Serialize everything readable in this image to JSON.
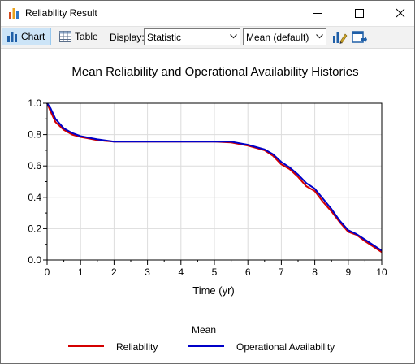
{
  "window": {
    "title": "Reliability Result",
    "controls": [
      "minimize",
      "maximize",
      "close"
    ]
  },
  "toolbar": {
    "chart_label": "Chart",
    "table_label": "Table",
    "display_label": "Display:",
    "display_select": "Statistic",
    "statistic_select": "Mean (default)",
    "icons": [
      "chart-properties-icon",
      "export-icon"
    ]
  },
  "colors": {
    "reliability": "#d40000",
    "availability": "#0000c8",
    "selected_tab": "#cce4f7"
  },
  "chart_data": {
    "type": "line",
    "title": "Mean Reliability and Operational Availability Histories",
    "xlabel": "Time (yr)",
    "ylabel": "",
    "xlim": [
      0,
      10
    ],
    "ylim": [
      0,
      1.0
    ],
    "x_ticks": [
      "0",
      "1",
      "2",
      "3",
      "4",
      "5",
      "6",
      "7",
      "8",
      "9",
      "10"
    ],
    "y_ticks": [
      "0.0",
      "0.2",
      "0.4",
      "0.6",
      "0.8",
      "1.0"
    ],
    "grid": true,
    "legend_title": "Mean",
    "legend_position": "bottom",
    "series": [
      {
        "name": "Reliability",
        "color": "#d40000",
        "x": [
          0,
          0.1,
          0.25,
          0.5,
          0.75,
          1.0,
          1.25,
          1.5,
          2.0,
          3.0,
          4.0,
          5.0,
          5.5,
          6.0,
          6.25,
          6.5,
          6.75,
          7.0,
          7.25,
          7.5,
          7.75,
          8.0,
          8.25,
          8.5,
          8.75,
          9.0,
          9.25,
          9.5,
          10.0
        ],
        "y": [
          1.0,
          0.95,
          0.88,
          0.83,
          0.8,
          0.785,
          0.775,
          0.765,
          0.755,
          0.755,
          0.755,
          0.755,
          0.75,
          0.73,
          0.715,
          0.7,
          0.665,
          0.61,
          0.58,
          0.53,
          0.47,
          0.44,
          0.37,
          0.31,
          0.24,
          0.18,
          0.16,
          0.12,
          0.05
        ]
      },
      {
        "name": "Operational Availability",
        "color": "#0000c8",
        "x": [
          0,
          0.1,
          0.25,
          0.5,
          0.75,
          1.0,
          1.25,
          1.5,
          2.0,
          3.0,
          4.0,
          5.0,
          5.5,
          6.0,
          6.25,
          6.5,
          6.75,
          7.0,
          7.25,
          7.5,
          7.75,
          8.0,
          8.25,
          8.5,
          8.75,
          9.0,
          9.25,
          9.5,
          10.0
        ],
        "y": [
          1.0,
          0.97,
          0.9,
          0.84,
          0.81,
          0.79,
          0.78,
          0.77,
          0.755,
          0.755,
          0.755,
          0.755,
          0.755,
          0.735,
          0.72,
          0.705,
          0.675,
          0.625,
          0.59,
          0.545,
          0.49,
          0.455,
          0.39,
          0.325,
          0.25,
          0.19,
          0.165,
          0.13,
          0.06
        ]
      }
    ]
  }
}
